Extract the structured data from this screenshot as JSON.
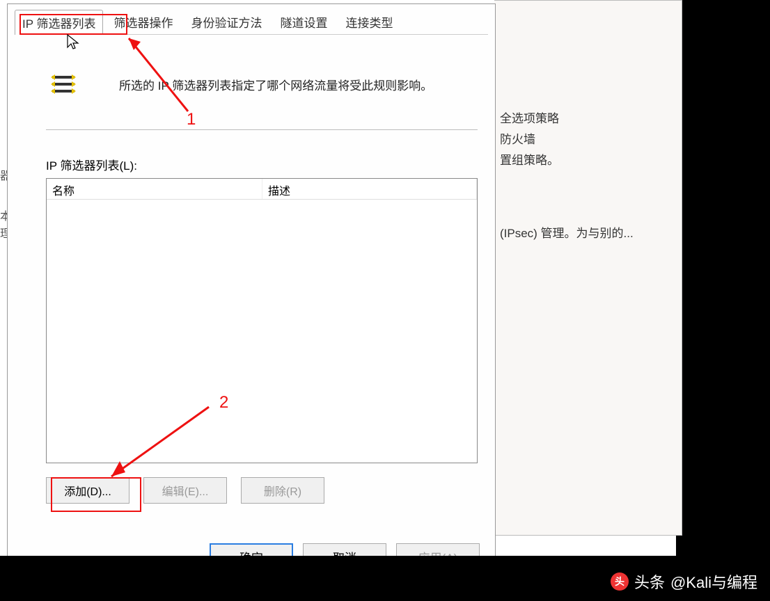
{
  "background": {
    "line1": "全选项策略",
    "line2": "防火墙",
    "line3": "置组策略。",
    "line4": "(IPsec) 管理。为与别的...",
    "leftedge": [
      "器",
      "本",
      "理"
    ]
  },
  "dialog": {
    "tabs": [
      {
        "label": "IP 筛选器列表",
        "active": true
      },
      {
        "label": "筛选器操作",
        "active": false
      },
      {
        "label": "身份验证方法",
        "active": false
      },
      {
        "label": "隧道设置",
        "active": false
      },
      {
        "label": "连接类型",
        "active": false
      }
    ],
    "info_text": "所选的 IP 筛选器列表指定了哪个网络流量将受此规则影响。",
    "list_label": "IP 筛选器列表(L):",
    "columns": {
      "name": "名称",
      "desc": "描述"
    },
    "rows": [],
    "buttons": {
      "add": "添加(D)...",
      "edit": "编辑(E)...",
      "remove": "删除(R)"
    },
    "dlg_buttons": {
      "ok": "确定",
      "cancel": "取消",
      "apply": "应用(A)"
    }
  },
  "annotations": {
    "num1": "1",
    "num2": "2"
  },
  "watermark": {
    "prefix": "头条",
    "handle": "@Kali与编程"
  }
}
